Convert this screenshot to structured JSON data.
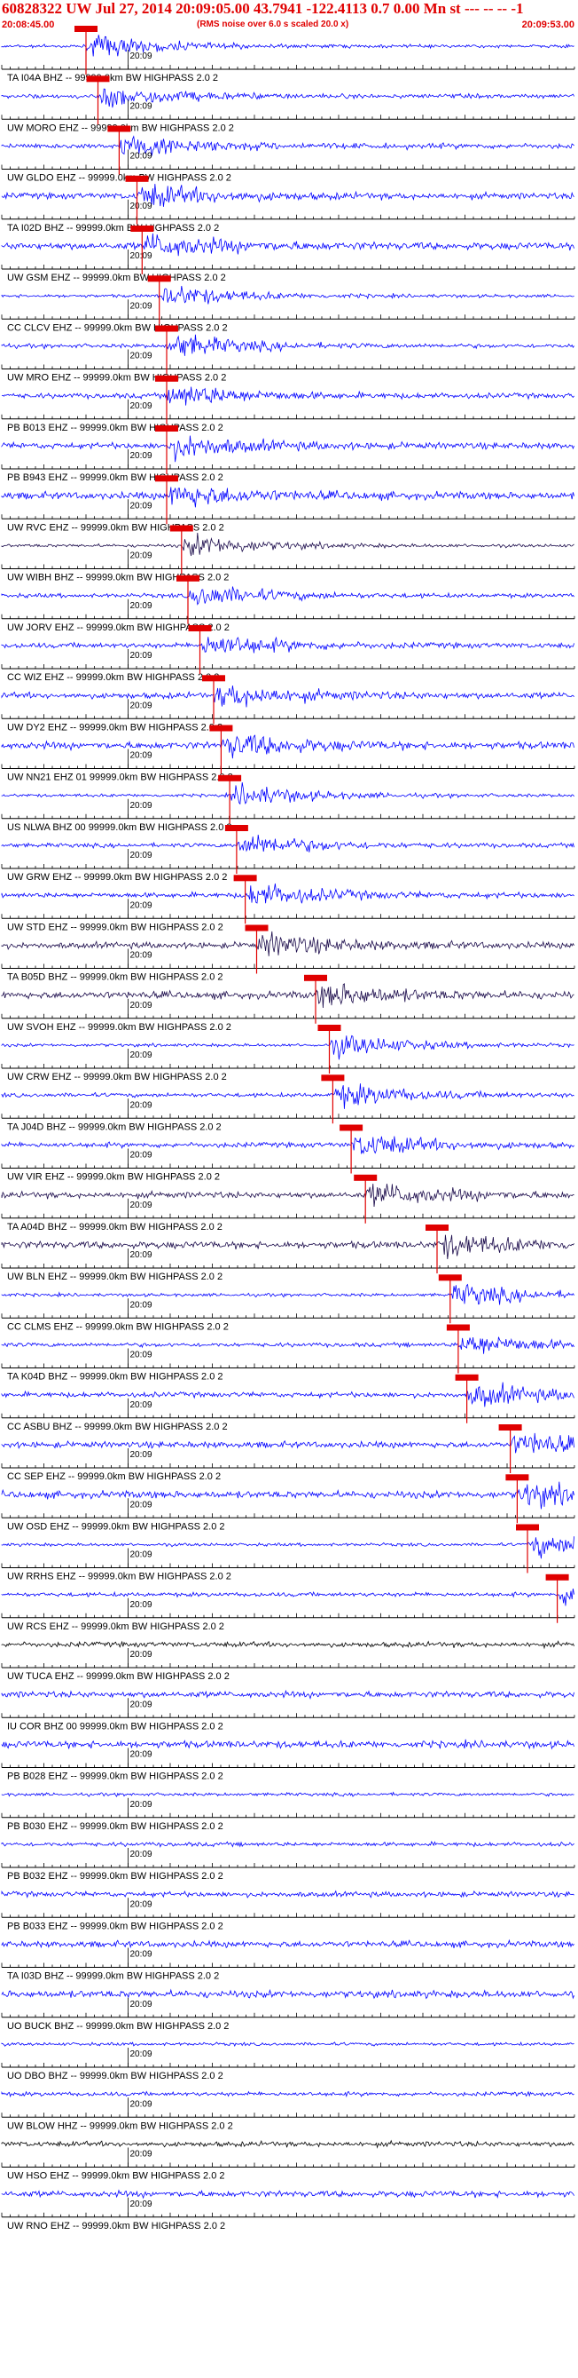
{
  "header": {
    "title": "60828322 UW Jul 27, 2014 20:09:05.00   43.7941 -122.4113  0.7 0.00 Mn st --- -- --  -1",
    "start_time": "20:08:45.00",
    "rms_note": "(RMS noise over 6.0 s scaled 20.0 x)",
    "end_time": "20:09:53.00"
  },
  "colors": {
    "trace_blue": "#0000ff",
    "trace_dark": "#1a0a4a",
    "trace_black": "#000000",
    "pick_red": "#e00000",
    "axis_black": "#000000"
  },
  "chart_data": {
    "type": "line",
    "title": "60828322 UW Jul 27, 2014 20:09:05.00   43.7941 -122.4113  0.7 0.00 Mn st --- -- --  -1",
    "x_range": [
      "20:08:45.00",
      "20:09:53.00"
    ],
    "tick_label": "20:09",
    "series": [
      {
        "name": "TA I04A BHZ -- 99999.0km BW  HIGHPASS  2.0  2",
        "pick_frac": 0.147
      },
      {
        "name": "UW MORO EHZ -- 99999.0km BW  HIGHPASS  2.0  2",
        "pick_frac": 0.168
      },
      {
        "name": "UW GLDO EHZ -- 99999.0km BW  HIGHPASS  2.0  2",
        "pick_frac": 0.205
      },
      {
        "name": "TA I02D BHZ -- 99999.0km BW  HIGHPASS  2.0  2",
        "pick_frac": 0.236
      },
      {
        "name": "UW GSM EHZ -- 99999.0km BW  HIGHPASS  2.0  2",
        "pick_frac": 0.245
      },
      {
        "name": "CC CLCV EHZ -- 99999.0km BW  HIGHPASS  2.0  2",
        "pick_frac": 0.275
      },
      {
        "name": "UW MRO EHZ -- 99999.0km BW  HIGHPASS  2.0  2",
        "pick_frac": 0.288
      },
      {
        "name": "PB B013 EHZ -- 99999.0km BW  HIGHPASS  2.0  2",
        "pick_frac": 0.288
      },
      {
        "name": "PB B943 EHZ -- 99999.0km BW  HIGHPASS  2.0  2",
        "pick_frac": 0.288
      },
      {
        "name": "UW RVC EHZ -- 99999.0km BW  HIGHPASS  2.0  2",
        "pick_frac": 0.288
      },
      {
        "name": "UW WIBH BHZ -- 99999.0km BW  HIGHPASS  2.0  2",
        "pick_frac": 0.314
      },
      {
        "name": "UW JORV EHZ -- 99999.0km BW  HIGHPASS  2.0  2",
        "pick_frac": 0.325
      },
      {
        "name": "CC WIZ EHZ -- 99999.0km BW  HIGHPASS  2.0  2",
        "pick_frac": 0.346
      },
      {
        "name": "UW DY2 EHZ -- 99999.0km BW  HIGHPASS  2.0  2",
        "pick_frac": 0.37
      },
      {
        "name": "UW NN21 EHZ 01 99999.0km BW  HIGHPASS  2.0  2",
        "pick_frac": 0.383
      },
      {
        "name": "US NLWA BHZ 00 99999.0km BW  HIGHPASS  2.0  2",
        "pick_frac": 0.398
      },
      {
        "name": "UW GRW EHZ -- 99999.0km BW  HIGHPASS  2.0  2",
        "pick_frac": 0.41
      },
      {
        "name": "UW STD EHZ -- 99999.0km BW  HIGHPASS  2.0  2",
        "pick_frac": 0.425
      },
      {
        "name": "TA B05D BHZ -- 99999.0km BW  HIGHPASS  2.0  2",
        "pick_frac": 0.445
      },
      {
        "name": "UW SVOH EHZ -- 99999.0km BW  HIGHPASS  2.0  2",
        "pick_frac": 0.548
      },
      {
        "name": "UW CRW EHZ -- 99999.0km BW  HIGHPASS  2.0  2",
        "pick_frac": 0.572
      },
      {
        "name": "TA J04D BHZ -- 99999.0km BW  HIGHPASS  2.0  2",
        "pick_frac": 0.578
      },
      {
        "name": "UW VIR EHZ -- 99999.0km BW  HIGHPASS  2.0  2",
        "pick_frac": 0.61
      },
      {
        "name": "TA A04D BHZ -- 99999.0km BW  HIGHPASS  2.0  2",
        "pick_frac": 0.635
      },
      {
        "name": "UW BLN EHZ -- 99999.0km BW  HIGHPASS  2.0  2",
        "pick_frac": 0.76
      },
      {
        "name": "CC CLMS EHZ -- 99999.0km BW  HIGHPASS  2.0  2",
        "pick_frac": 0.783
      },
      {
        "name": "TA K04D BHZ -- 99999.0km BW  HIGHPASS  2.0  2",
        "pick_frac": 0.797
      },
      {
        "name": "CC ASBU BHZ -- 99999.0km BW  HIGHPASS  2.0  2",
        "pick_frac": 0.812
      },
      {
        "name": "CC SEP EHZ -- 99999.0km BW  HIGHPASS  2.0  2",
        "pick_frac": 0.888
      },
      {
        "name": "UW OSD EHZ -- 99999.0km BW  HIGHPASS  2.0  2",
        "pick_frac": 0.9
      },
      {
        "name": "UW RRHS EHZ -- 99999.0km BW  HIGHPASS  2.0  2",
        "pick_frac": 0.918
      },
      {
        "name": "UW RCS EHZ -- 99999.0km BW  HIGHPASS  2.0  2",
        "pick_frac": 0.97
      },
      {
        "name": "UW TUCA EHZ -- 99999.0km BW  HIGHPASS  2.0  2",
        "pick_frac": null
      },
      {
        "name": "IU COR BHZ 00 99999.0km BW  HIGHPASS  2.0  2",
        "pick_frac": null
      },
      {
        "name": "PB B028 EHZ -- 99999.0km BW  HIGHPASS  2.0  2",
        "pick_frac": null
      },
      {
        "name": "PB B030 EHZ -- 99999.0km BW  HIGHPASS  2.0  2",
        "pick_frac": null
      },
      {
        "name": "PB B032 EHZ -- 99999.0km BW  HIGHPASS  2.0  2",
        "pick_frac": null
      },
      {
        "name": "PB B033 EHZ -- 99999.0km BW  HIGHPASS  2.0  2",
        "pick_frac": null
      },
      {
        "name": "TA I03D BHZ -- 99999.0km BW  HIGHPASS  2.0  2",
        "pick_frac": null
      },
      {
        "name": "UO BUCK BHZ -- 99999.0km BW  HIGHPASS  2.0  2",
        "pick_frac": null
      },
      {
        "name": "UO DBO BHZ -- 99999.0km BW  HIGHPASS  2.0  2",
        "pick_frac": null
      },
      {
        "name": "UW BLOW HHZ -- 99999.0km BW  HIGHPASS  2.0  2",
        "pick_frac": null
      },
      {
        "name": "UW HSO EHZ -- 99999.0km BW  HIGHPASS  2.0  2",
        "pick_frac": null
      },
      {
        "name": "UW RNO EHZ -- 99999.0km BW  HIGHPASS  2.0  2",
        "pick_frac": null
      }
    ]
  }
}
